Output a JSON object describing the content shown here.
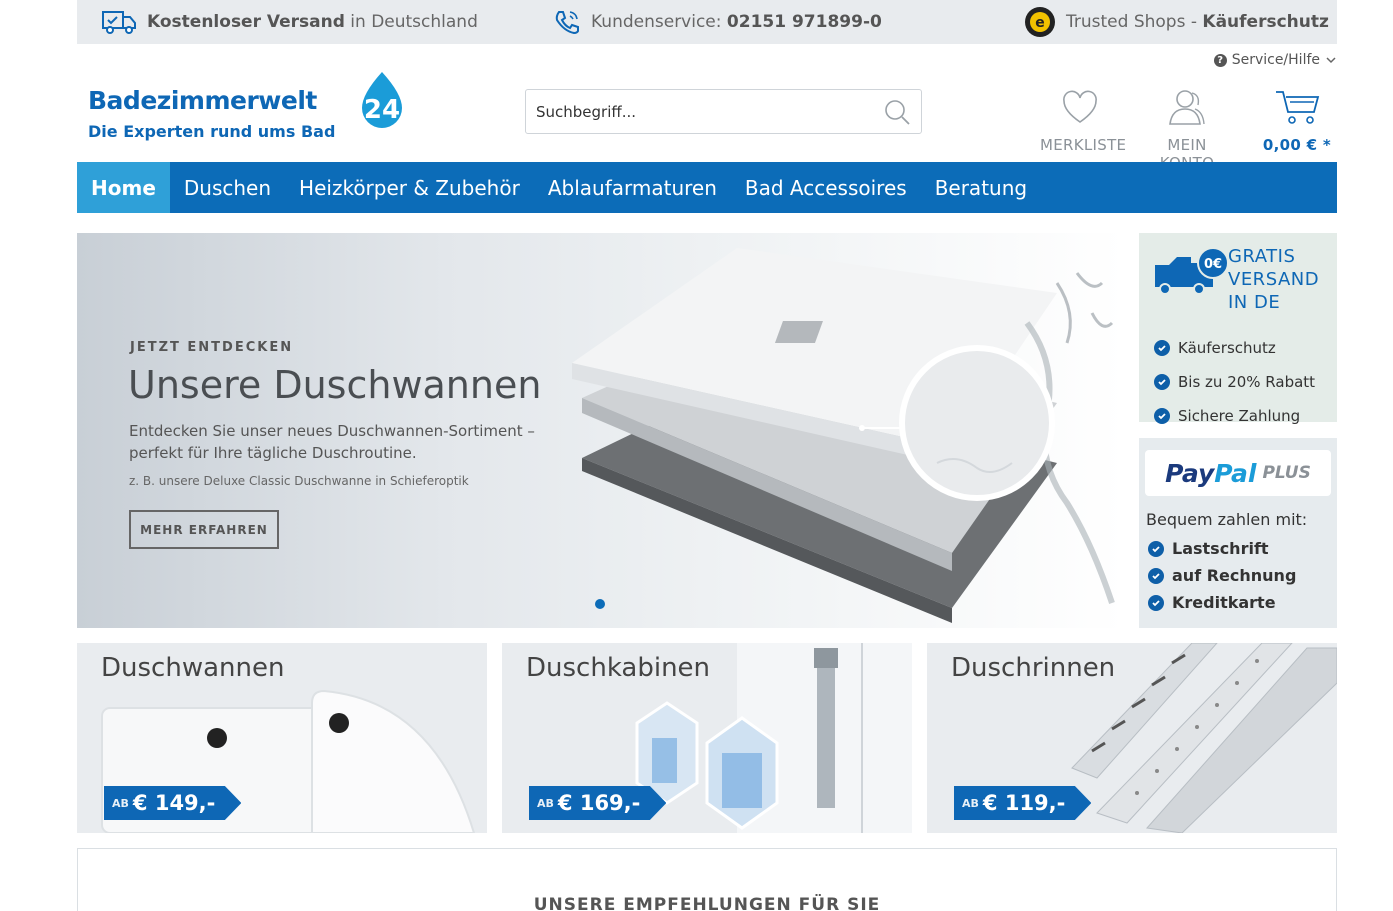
{
  "topbar": {
    "shipping_bold": "Kostenloser Versand",
    "shipping_rest": " in Deutschland",
    "service_label": "Kundenservice: ",
    "service_phone": "02151 971899-0",
    "trusted_label": "Trusted Shops - ",
    "trusted_bold": "Käuferschutz"
  },
  "header": {
    "service_link": "Service/Hilfe",
    "brand": "Badezimmerwelt",
    "brand_number": "24",
    "tagline": "Die Experten rund ums Bad",
    "search_placeholder": "Suchbegriff...",
    "wishlist_label": "MERKLISTE",
    "account_label": "MEIN KONTO",
    "cart_label": "0,00 € *"
  },
  "nav": {
    "items": [
      {
        "label": "Home",
        "active": true
      },
      {
        "label": "Duschen"
      },
      {
        "label": "Heizkörper & Zubehör"
      },
      {
        "label": "Ablaufarmaturen"
      },
      {
        "label": "Bad Accessoires"
      },
      {
        "label": "Beratung"
      }
    ]
  },
  "hero": {
    "kicker": "JETZT ENTDECKEN",
    "title": "Unsere Duschwannen",
    "desc": "Entdecken Sie unser neues Duschwannen-Sortiment – perfekt für Ihre tägliche Duschroutine.",
    "small": "z. B. unsere Deluxe Classic Duschwanne in Schieferoptik",
    "button": "MEHR ERFAHREN"
  },
  "side_shipping": {
    "badge": "0€",
    "head_line1": "GRATIS",
    "head_line2": "VERSAND",
    "head_line3": "IN DE",
    "items": [
      "Käuferschutz",
      "Bis zu 20% Rabatt",
      "Sichere Zahlung"
    ]
  },
  "side_paypal": {
    "logo_pay": "Pay",
    "logo_pal": "Pal",
    "logo_plus": "PLUS",
    "caption": "Bequem zahlen mit:",
    "items": [
      "Lastschrift",
      "auf Rechnung",
      "Kreditkarte"
    ]
  },
  "tiles": [
    {
      "name": "Duschwannen",
      "ab": "AB",
      "price": "€ 149,-"
    },
    {
      "name": "Duschkabinen",
      "ab": "AB",
      "price": "€ 169,-"
    },
    {
      "name": "Duschrinnen",
      "ab": "AB",
      "price": "€ 119,-"
    }
  ],
  "recommend": {
    "title": "UNSERE EMPFEHLUNGEN FÜR SIE"
  },
  "colors": {
    "brand_blue": "#0c6cb8",
    "nav_active": "#2fa0d8",
    "topbar_bg": "#e8ebee"
  }
}
